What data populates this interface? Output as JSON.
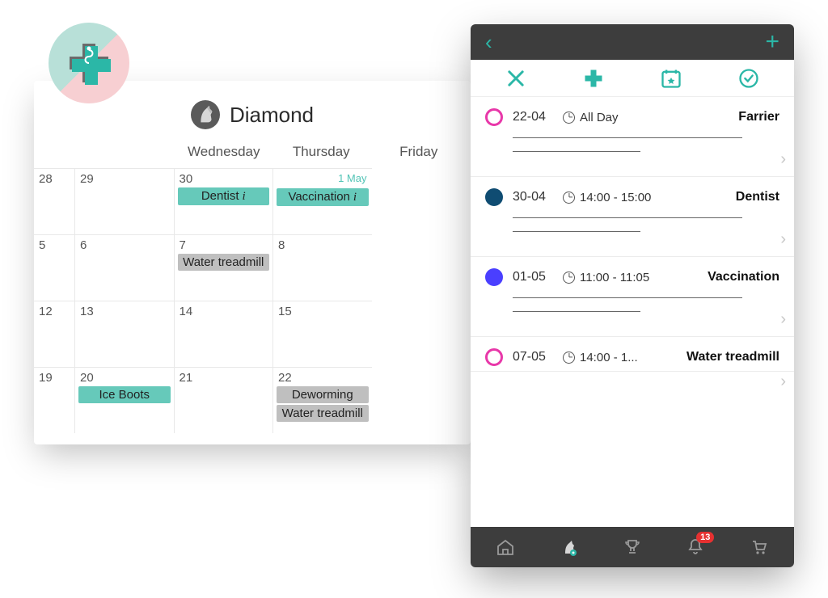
{
  "colors": {
    "teal": "#66c9ba",
    "gray": "#bfbfbf",
    "accent": "#2bb7a7",
    "pink": "#e838a9",
    "navy": "#0f4c72",
    "blue": "#4a3fff",
    "red": "#e63131"
  },
  "calendar": {
    "title": "Diamond",
    "dayHeaders": {
      "wed": "Wednesday",
      "thu": "Thursday",
      "fri": "Friday"
    },
    "weeks": [
      {
        "wk": "28",
        "cells": [
          {
            "num": "29"
          },
          {
            "num": "30",
            "evt1": "Dentist",
            "evt1color": "teal",
            "evt1info": true
          },
          {
            "num": "",
            "monthtag": "1 May",
            "evt1": "Vaccination",
            "evt1color": "teal",
            "evt1info": true
          }
        ]
      },
      {
        "wk": "5",
        "cells": [
          {
            "num": "6"
          },
          {
            "num": "7",
            "evt1": "Water treadmill",
            "evt1color": "gray"
          },
          {
            "num": "8"
          }
        ]
      },
      {
        "wk": "12",
        "cells": [
          {
            "num": "13"
          },
          {
            "num": "14"
          },
          {
            "num": "15"
          }
        ]
      },
      {
        "wk": "19",
        "cells": [
          {
            "num": "20",
            "evt1": "Ice Boots",
            "evt1color": "teal"
          },
          {
            "num": "21"
          },
          {
            "num": "22",
            "evt1": "Deworming",
            "evt1color": "gray",
            "evt2": "Water treadmill",
            "evt2color": "gray"
          }
        ]
      }
    ]
  },
  "phone": {
    "notificationCount": "13",
    "items": [
      {
        "date": "22-04",
        "time": "All Day",
        "title": "Farrier",
        "dot": "hollow"
      },
      {
        "date": "30-04",
        "time": "14:00 - 15:00",
        "title": "Dentist",
        "dot": "navy"
      },
      {
        "date": "01-05",
        "time": "11:00 - 11:05",
        "title": "Vaccination",
        "dot": "blue"
      },
      {
        "date": "07-05",
        "time": "14:00 - 1...",
        "title": "Water treadmill",
        "dot": "hollow"
      }
    ]
  }
}
